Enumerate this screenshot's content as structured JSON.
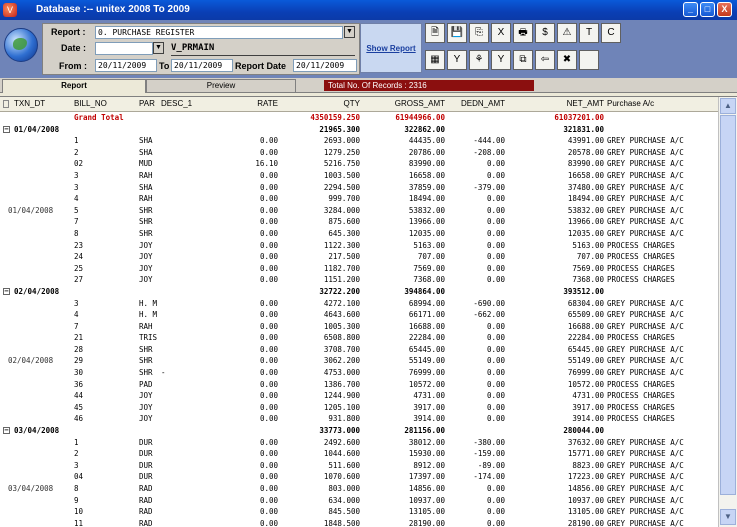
{
  "window": {
    "title": "Database :-- unitex   2008  To  2009",
    "app_icon": "V",
    "min": "_",
    "max": "□",
    "close": "X"
  },
  "form": {
    "report_label": "Report :",
    "report_value": "0. PURCHASE REGISTER",
    "date_label": "Date :",
    "date_value": "",
    "view_name": "V_PRMAIN",
    "from_label": "From :",
    "from_value": "20/11/2009",
    "to_label": "To",
    "to_value": "20/11/2009",
    "report_date_label": "Report Date",
    "report_date_value": "20/11/2009",
    "show_report": "Show Report",
    "dropdown_arrow": "▼"
  },
  "toolbar": {
    "row1": [
      {
        "name": "print-preview-icon",
        "glyph": "🗎"
      },
      {
        "name": "save-icon",
        "glyph": "💾"
      },
      {
        "name": "copy-icon",
        "glyph": "⎘"
      },
      {
        "name": "excel-icon",
        "glyph": "X"
      },
      {
        "name": "printer-icon",
        "glyph": "🖶"
      },
      {
        "name": "sort-icon",
        "glyph": "$"
      },
      {
        "name": "warning-icon",
        "glyph": "⚠"
      },
      {
        "name": "font-icon",
        "glyph": "T"
      },
      {
        "name": "columns-icon",
        "glyph": "C"
      }
    ],
    "row2": [
      {
        "name": "grid-settings-icon",
        "glyph": "▦"
      },
      {
        "name": "filter-icon",
        "glyph": "Y"
      },
      {
        "name": "filter-clear-icon",
        "glyph": "⚘"
      },
      {
        "name": "filter-remove-icon",
        "glyph": "Y"
      },
      {
        "name": "export-icon",
        "glyph": "⧉"
      },
      {
        "name": "back-icon",
        "glyph": "⇦"
      },
      {
        "name": "cancel-icon",
        "glyph": "✖"
      },
      {
        "name": "blank-icon",
        "glyph": ""
      }
    ]
  },
  "tabs": {
    "report": "Report",
    "preview": "Preview",
    "records": "Total No. Of Records : 2316"
  },
  "columns": [
    "TXN_DT",
    "BILL_NO",
    "PAR",
    "DESC_1",
    "RATE",
    "QTY",
    "GROSS_AMT",
    "DEDN_AMT",
    "NET_AMT",
    "Purchase A/c"
  ],
  "grand_total": {
    "label": "Grand Total",
    "qty": "4350159.250",
    "gross": "61944966.00",
    "net": "61037201.00"
  },
  "groups": [
    {
      "date": "01/04/2008",
      "qty": "21965.300",
      "gross": "322862.00",
      "net": "321831.00",
      "label_row": 6,
      "rows": [
        [
          "1",
          "SHA",
          "",
          "0.00",
          "2693.000",
          "44435.00",
          "-444.00",
          "43991.00",
          "GREY PURCHASE A/C"
        ],
        [
          "2",
          "SHA",
          "",
          "0.00",
          "1279.250",
          "20786.00",
          "-208.00",
          "20578.00",
          "GREY PURCHASE A/C"
        ],
        [
          "02",
          "MUD",
          "",
          "16.10",
          "5216.750",
          "83990.00",
          "0.00",
          "83990.00",
          "GREY PURCHASE A/C"
        ],
        [
          "3",
          "RAH",
          "",
          "0.00",
          "1003.500",
          "16658.00",
          "0.00",
          "16658.00",
          "GREY PURCHASE A/C"
        ],
        [
          "3",
          "SHA",
          "",
          "0.00",
          "2294.500",
          "37859.00",
          "-379.00",
          "37480.00",
          "GREY PURCHASE A/C"
        ],
        [
          "4",
          "RAH",
          "",
          "0.00",
          "999.700",
          "18494.00",
          "0.00",
          "18494.00",
          "GREY PURCHASE A/C"
        ],
        [
          "5",
          "SHR",
          "",
          "0.00",
          "3284.000",
          "53832.00",
          "0.00",
          "53832.00",
          "GREY PURCHASE A/C"
        ],
        [
          "7",
          "SHR",
          "",
          "0.00",
          "875.600",
          "13966.00",
          "0.00",
          "13966.00",
          "GREY PURCHASE A/C"
        ],
        [
          "8",
          "SHR",
          "",
          "0.00",
          "645.300",
          "12035.00",
          "0.00",
          "12035.00",
          "GREY PURCHASE A/C"
        ],
        [
          "23",
          "JOY",
          "",
          "0.00",
          "1122.300",
          "5163.00",
          "0.00",
          "5163.00",
          "PROCESS CHARGES"
        ],
        [
          "24",
          "JOY",
          "",
          "0.00",
          "217.500",
          "707.00",
          "0.00",
          "707.00",
          "PROCESS CHARGES"
        ],
        [
          "25",
          "JOY",
          "",
          "0.00",
          "1182.700",
          "7569.00",
          "0.00",
          "7569.00",
          "PROCESS CHARGES"
        ],
        [
          "27",
          "JOY",
          "",
          "0.00",
          "1151.200",
          "7368.00",
          "0.00",
          "7368.00",
          "PROCESS CHARGES"
        ]
      ]
    },
    {
      "date": "02/04/2008",
      "qty": "32722.200",
      "gross": "394864.00",
      "net": "393512.00",
      "label_row": 5,
      "rows": [
        [
          "3",
          "H. M",
          "",
          "0.00",
          "4272.100",
          "68994.00",
          "-690.00",
          "68304.00",
          "GREY PURCHASE A/C"
        ],
        [
          "4",
          "H. M",
          "",
          "0.00",
          "4643.600",
          "66171.00",
          "-662.00",
          "65509.00",
          "GREY PURCHASE A/C"
        ],
        [
          "7",
          "RAH",
          "",
          "0.00",
          "1005.300",
          "16688.00",
          "0.00",
          "16688.00",
          "GREY PURCHASE A/C"
        ],
        [
          "21",
          "TRIS",
          "",
          "0.00",
          "6508.800",
          "22284.00",
          "0.00",
          "22284.00",
          "PROCESS CHARGES"
        ],
        [
          "28",
          "SHR",
          "",
          "0.00",
          "3708.700",
          "65445.00",
          "0.00",
          "65445.00",
          "GREY PURCHASE A/C"
        ],
        [
          "29",
          "SHR",
          "",
          "0.00",
          "3062.200",
          "55149.00",
          "0.00",
          "55149.00",
          "GREY PURCHASE A/C"
        ],
        [
          "30",
          "SHR",
          "-",
          "0.00",
          "4753.000",
          "76999.00",
          "0.00",
          "76999.00",
          "GREY PURCHASE A/C"
        ],
        [
          "36",
          "PAD",
          "",
          "0.00",
          "1386.700",
          "10572.00",
          "0.00",
          "10572.00",
          "PROCESS CHARGES"
        ],
        [
          "44",
          "JOY",
          "",
          "0.00",
          "1244.900",
          "4731.00",
          "0.00",
          "4731.00",
          "PROCESS CHARGES"
        ],
        [
          "45",
          "JOY",
          "",
          "0.00",
          "1205.100",
          "3917.00",
          "0.00",
          "3917.00",
          "PROCESS CHARGES"
        ],
        [
          "46",
          "JOY",
          "",
          "0.00",
          "931.800",
          "3914.00",
          "0.00",
          "3914.00",
          "PROCESS CHARGES"
        ]
      ]
    },
    {
      "date": "03/04/2008",
      "qty": "33773.000",
      "gross": "281156.00",
      "net": "280044.00",
      "label_row": 4,
      "rows": [
        [
          "1",
          "DUR",
          "",
          "0.00",
          "2492.600",
          "38012.00",
          "-380.00",
          "37632.00",
          "GREY PURCHASE A/C"
        ],
        [
          "2",
          "DUR",
          "",
          "0.00",
          "1044.600",
          "15930.00",
          "-159.00",
          "15771.00",
          "GREY PURCHASE A/C"
        ],
        [
          "3",
          "DUR",
          "",
          "0.00",
          "511.600",
          "8912.00",
          "-89.00",
          "8823.00",
          "GREY PURCHASE A/C"
        ],
        [
          "04",
          "DUR",
          "",
          "0.00",
          "1070.600",
          "17397.00",
          "-174.00",
          "17223.00",
          "GREY PURCHASE A/C"
        ],
        [
          "8",
          "RAD",
          "",
          "0.00",
          "803.000",
          "14856.00",
          "0.00",
          "14856.00",
          "GREY PURCHASE A/C"
        ],
        [
          "9",
          "RAD",
          "",
          "0.00",
          "634.000",
          "10937.00",
          "0.00",
          "10937.00",
          "GREY PURCHASE A/C"
        ],
        [
          "10",
          "RAD",
          "",
          "0.00",
          "845.500",
          "13105.00",
          "0.00",
          "13105.00",
          "GREY PURCHASE A/C"
        ],
        [
          "11",
          "RAD",
          "",
          "0.00",
          "1848.500",
          "28190.00",
          "0.00",
          "28190.00",
          "GREY PURCHASE A/C"
        ]
      ]
    }
  ],
  "expander_glyph": "−",
  "scroll": {
    "up": "▲",
    "down": "▼"
  }
}
